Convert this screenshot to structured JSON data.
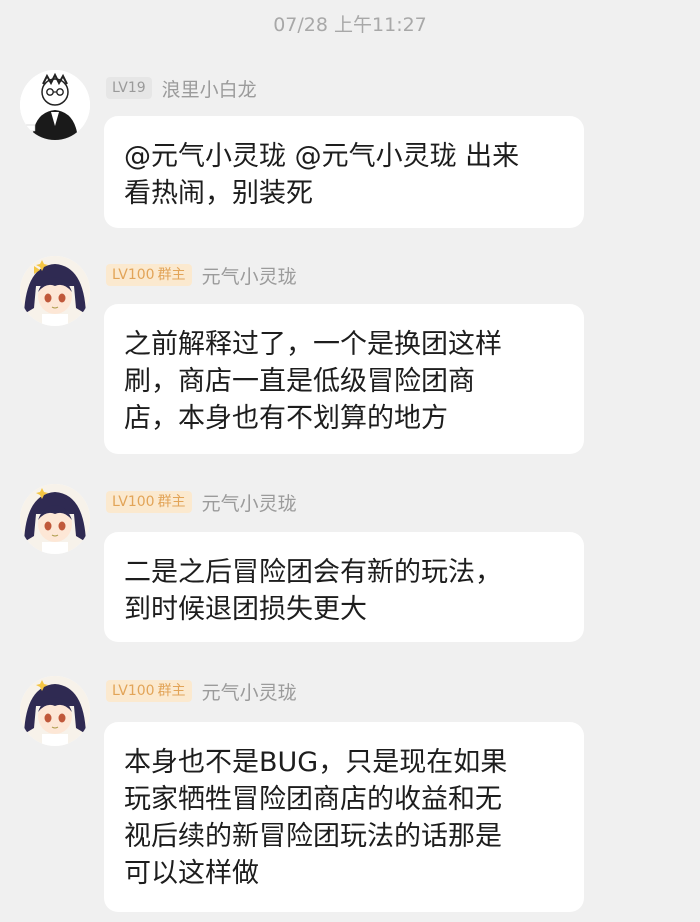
{
  "timestamp": "07/28 上午11:27",
  "messages": [
    {
      "level": "LV19",
      "role": "",
      "name": "浪里小白龙",
      "text": "@元气小灵珑 @元气小灵珑 出来\n看热闹，别装死"
    },
    {
      "level": "LV100",
      "role": "群主",
      "name": "元气小灵珑",
      "text": "之前解释过了，一个是换团这样\n刷，商店一直是低级冒险团商\n店，本身也有不划算的地方"
    },
    {
      "level": "LV100",
      "role": "群主",
      "name": "元气小灵珑",
      "text": "二是之后冒险团会有新的玩法，\n到时候退团损失更大"
    },
    {
      "level": "LV100",
      "role": "群主",
      "name": "元气小灵珑",
      "text": "本身也不是BUG，只是现在如果\n玩家牺牲冒险团商店的收益和无\n视后续的新冒险团玩法的话那是\n可以这样做"
    }
  ]
}
